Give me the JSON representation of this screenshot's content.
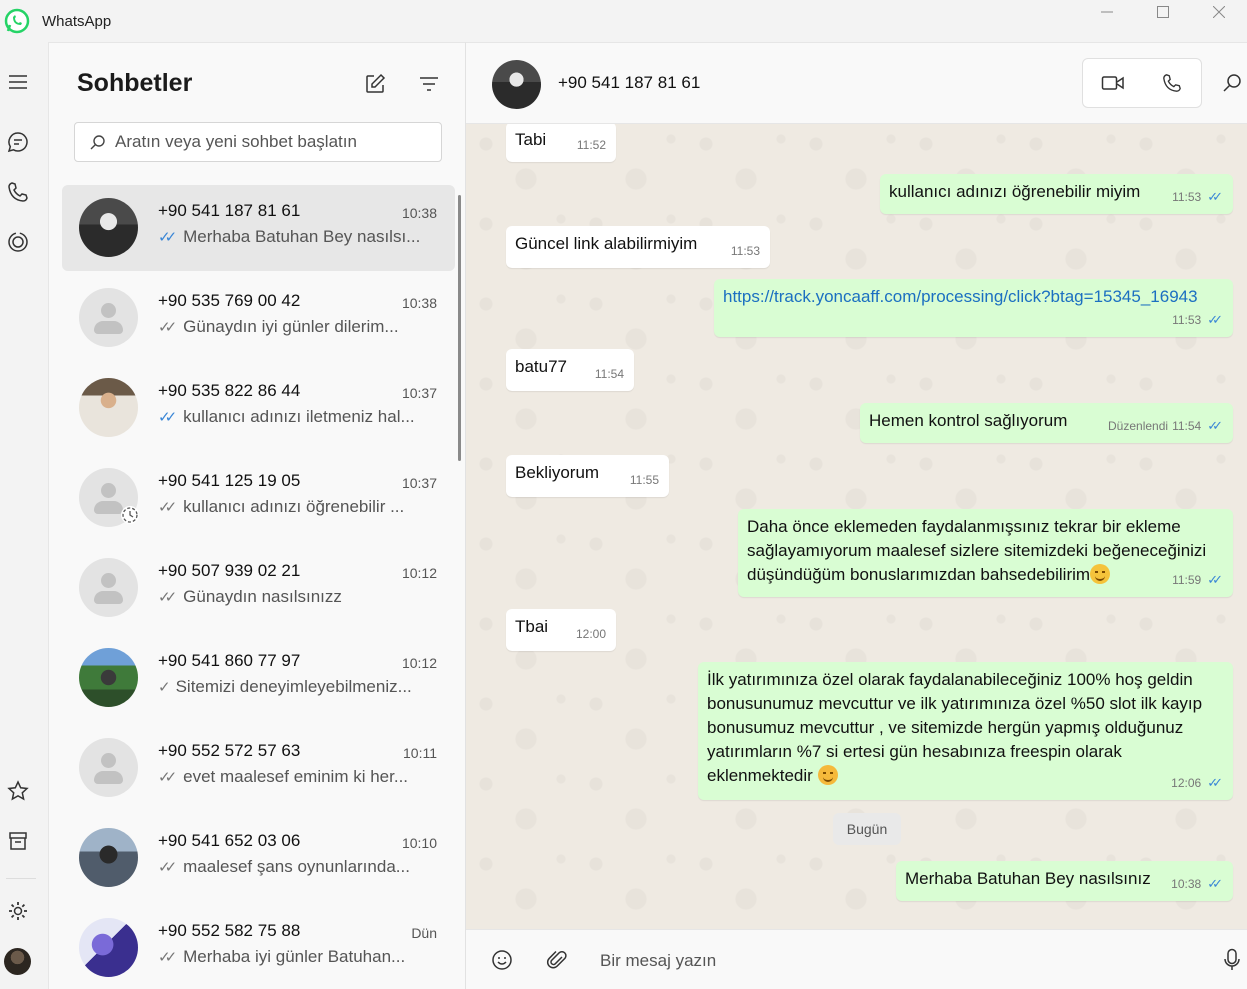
{
  "app": {
    "title": "WhatsApp"
  },
  "icons": {
    "logo": "whatsapp-logo",
    "minimize": "minimize-icon",
    "maximize": "maximize-icon",
    "close": "close-icon",
    "menu": "hamburger-icon",
    "chats": "chat-icon",
    "calls": "phone-icon",
    "status": "status-icon",
    "starred": "star-icon",
    "archived": "archive-icon",
    "settings": "gear-icon",
    "new_chat": "compose-icon",
    "filter": "filter-icon",
    "search": "search-icon",
    "video": "video-camera-icon",
    "voice": "phone-icon",
    "emoji": "emoji-icon",
    "attach": "paperclip-icon",
    "mic": "microphone-icon"
  },
  "colors": {
    "accent": "#25d366",
    "outgoing_bubble": "#d9fdd3",
    "read_tick": "#3a86d6",
    "chat_bg": "#efeae2"
  },
  "chatlist": {
    "title": "Sohbetler",
    "search_placeholder": "Aratın veya yeni sohbet başlatın",
    "chats": [
      {
        "name": "+90 541 187 81 61",
        "time": "10:38",
        "tick": "✓✓",
        "preview": "Merhaba Batuhan Bey nasılsı...",
        "active": true
      },
      {
        "name": "+90 535 769 00 42",
        "time": "10:38",
        "tick": "✓✓",
        "preview": "Günaydın iyi günler dilerim..."
      },
      {
        "name": "+90 535 822 86 44",
        "time": "10:37",
        "tick": "✓✓",
        "preview": "kullanıcı adınızı iletmeniz hal..."
      },
      {
        "name": "+90 541 125 19 05",
        "time": "10:37",
        "tick": "✓✓",
        "preview": "kullanıcı adınızı öğrenebilir ..."
      },
      {
        "name": "+90 507 939 02 21",
        "time": "10:12",
        "tick": "✓✓",
        "preview": "Günaydın nasılsınızz"
      },
      {
        "name": "+90 541 860 77 97",
        "time": "10:12",
        "tick": "✓",
        "preview": "Sitemizi deneyimleyebilmeniz..."
      },
      {
        "name": "+90 552 572 57 63",
        "time": "10:11",
        "tick": "✓✓",
        "preview": "evet maalesef eminim ki her..."
      },
      {
        "name": "+90 541 652 03 06",
        "time": "10:10",
        "tick": "✓✓",
        "preview": "maalesef şans oynunlarında..."
      },
      {
        "name": "+90 552 582 75 88",
        "time": "Dün",
        "tick": "✓✓",
        "preview": "Merhaba iyi günler  Batuhan..."
      }
    ]
  },
  "conversation": {
    "contact_name": "+90 541 187 81 61",
    "day_label": "Bugün",
    "composer_placeholder": "Bir mesaj yazın",
    "messages": [
      {
        "dir": "in",
        "text": "Tabi",
        "time": "11:52"
      },
      {
        "dir": "out",
        "text": "kullanıcı adınızı öğrenebilir miyim",
        "time": "11:53",
        "tick": "✓✓"
      },
      {
        "dir": "in",
        "text": "Güncel link alabilirmiyim",
        "time": "11:53"
      },
      {
        "dir": "out",
        "text": "https://track.yoncaaff.com/processing/click?btag=15345_16943",
        "time": "11:53",
        "tick": "✓✓"
      },
      {
        "dir": "in",
        "text": "batu77",
        "time": "11:54"
      },
      {
        "dir": "out",
        "text": "Hemen kontrol sağlıyorum",
        "edited": "Düzenlendi",
        "time": "11:54",
        "tick": "✓✓"
      },
      {
        "dir": "in",
        "text": "Bekliyorum",
        "time": "11:55"
      },
      {
        "dir": "out",
        "text": "Daha önce eklemeden faydalanmışsınız tekrar bir ekleme sağlayamıyorum maalesef sizlere sitemizdeki beğeneceğinizi düşündüğüm bonuslarımızdan bahsedebilirim",
        "emoji": "smiling-face-emoji",
        "time": "11:59",
        "tick": "✓✓"
      },
      {
        "dir": "in",
        "text": "Tbai",
        "time": "12:00"
      },
      {
        "dir": "out",
        "text": "İlk yatırımınıza özel olarak faydalanabileceğiniz   100% hoş geldin bonusunumuz mevcuttur ve ilk yatırımınıza özel %50 slot ilk kayıp bonusumuz mevcuttur , ve sitemizde  hergün yapmış olduğunuz yatırımların %7 si ertesi gün hesabınıza freespin olarak eklenmektedir",
        "emoji": "partying-face-emoji",
        "time": "12:06",
        "tick": "✓✓"
      },
      {
        "dir": "out",
        "text": "Merhaba Batuhan Bey nasılsınız",
        "time": "10:38",
        "tick": "✓✓"
      }
    ]
  }
}
